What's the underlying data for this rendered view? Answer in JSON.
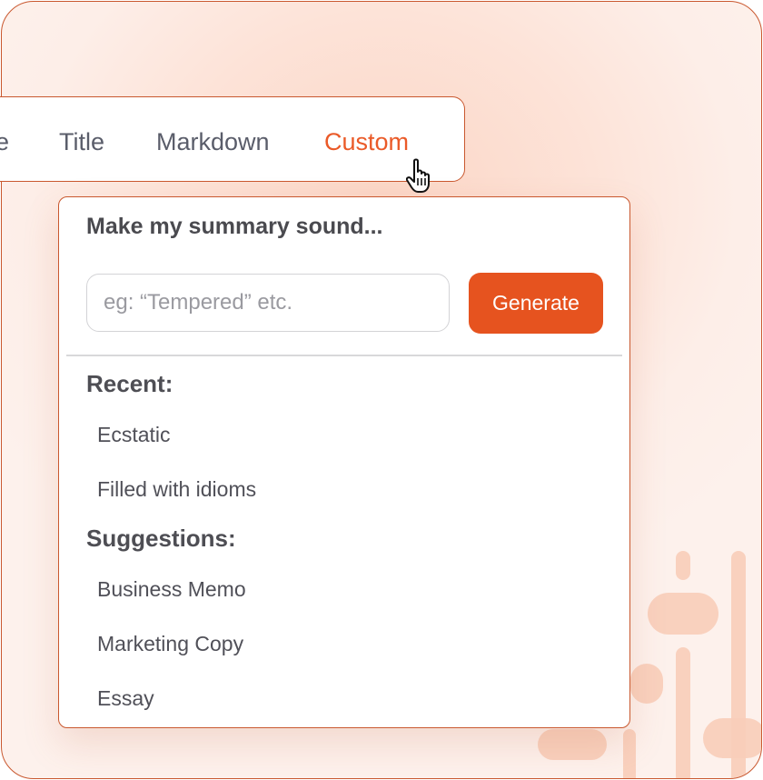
{
  "tabs": [
    {
      "label": "e"
    },
    {
      "label": "Title"
    },
    {
      "label": "Markdown"
    },
    {
      "label": "Custom",
      "active": true
    }
  ],
  "dropdown": {
    "title": "Make my summary sound...",
    "input": {
      "value": "",
      "placeholder": "eg: “Tempered” etc."
    },
    "generate_label": "Generate",
    "recent": {
      "heading": "Recent:",
      "items": [
        "Ecstatic",
        "Filled with idioms"
      ]
    },
    "suggestions": {
      "heading": "Suggestions:",
      "items": [
        "Business Memo",
        "Marketing Copy",
        "Essay"
      ]
    }
  },
  "colors": {
    "accent": "#e6531f",
    "border": "#c9582f",
    "text": "#505058",
    "background": "#fde3d8"
  },
  "icons": [
    "hand-pointer-cursor-icon"
  ]
}
